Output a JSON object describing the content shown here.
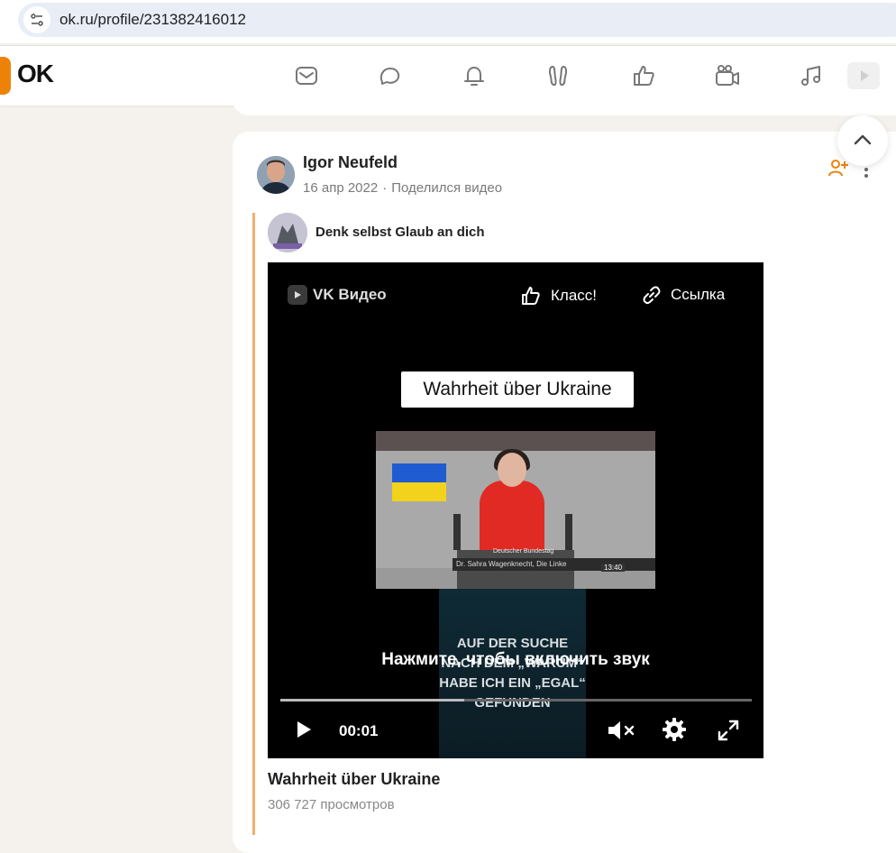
{
  "browser": {
    "url": "ok.ru/profile/231382416012"
  },
  "nav": {
    "logo": "OK",
    "icons": [
      "messages-icon",
      "discussions-icon",
      "notifications-icon",
      "guests-icon",
      "likes-icon",
      "video-icon",
      "music-icon",
      "video-showcase-icon"
    ]
  },
  "post": {
    "author": "Igor Neufeld",
    "date": "16 апр 2022",
    "action": "Поделился видео",
    "group_name": "Denk selbst Glaub an dich",
    "video": {
      "brand": "VK Видео",
      "klass_label": "Класс!",
      "link_label": "Ссылка",
      "overlay_title": "Wahrheit über Ukraine",
      "clip_lower_third": "Dr. Sahra Wagenknecht, Die Linke",
      "clip_channel": "Deutscher Bundestag",
      "clip_time": "13:40",
      "lower_clip_text": "AUF DER SUCHE NACH DEM „WARUM“ HABE ICH EIN „EGAL“ GEFUNDEN",
      "unmute_hint": "Нажмите, чтобы включить звук",
      "current_time": "00:01",
      "progress": 0.39
    },
    "title": "Wahrheit über Ukraine",
    "views": "306 727 просмотров"
  },
  "colors": {
    "brand": "#ee8208",
    "repost_bar": "#f0b070"
  }
}
